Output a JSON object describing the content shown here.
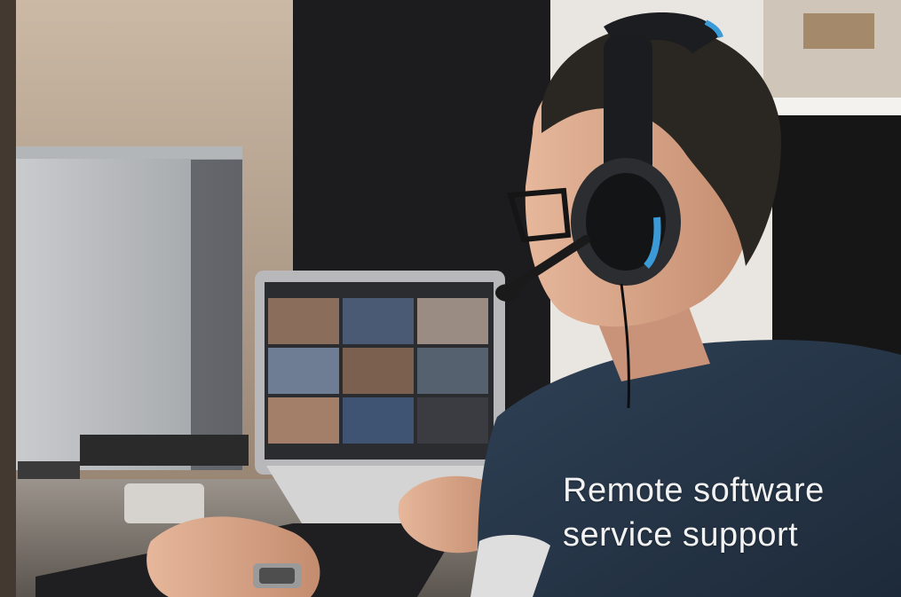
{
  "caption": {
    "line1": "Remote software",
    "line2": "service support"
  },
  "colors": {
    "caption_text": "#f2f2f2",
    "shirt": "#263648",
    "headset_accent": "#3a9bd8"
  },
  "icons": [
    "laptop-video-call-grid",
    "headset"
  ]
}
